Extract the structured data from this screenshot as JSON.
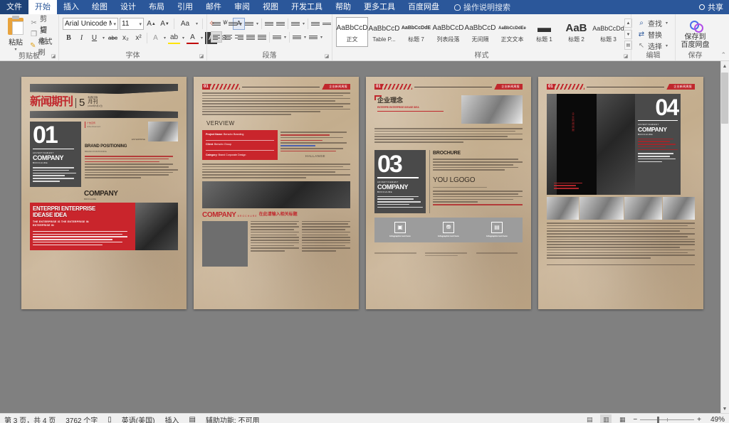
{
  "ribbon": {
    "tabs": [
      {
        "label": "文件",
        "kind": "file"
      },
      {
        "label": "开始",
        "kind": "active"
      },
      {
        "label": "插入",
        "kind": "normal"
      },
      {
        "label": "绘图",
        "kind": "normal"
      },
      {
        "label": "设计",
        "kind": "normal"
      },
      {
        "label": "布局",
        "kind": "normal"
      },
      {
        "label": "引用",
        "kind": "normal"
      },
      {
        "label": "邮件",
        "kind": "normal"
      },
      {
        "label": "审阅",
        "kind": "normal"
      },
      {
        "label": "视图",
        "kind": "normal"
      },
      {
        "label": "开发工具",
        "kind": "normal"
      },
      {
        "label": "帮助",
        "kind": "normal"
      },
      {
        "label": "更多工具",
        "kind": "normal"
      },
      {
        "label": "百度网盘",
        "kind": "normal"
      }
    ],
    "tell_me": "操作说明搜索",
    "share": "共享"
  },
  "clipboard": {
    "group_label": "剪贴板",
    "paste": "粘贴",
    "cut": "剪切",
    "copy": "复制",
    "format_painter": "格式刷"
  },
  "font": {
    "group_label": "字体",
    "font_name": "Arial Unicode M",
    "font_size": "11",
    "grow": "A",
    "shrink": "A",
    "change_case": "Aa",
    "bold": "B",
    "italic": "I",
    "underline": "U",
    "strikethrough": "abc",
    "subscript": "x₂",
    "superscript": "x²",
    "text_effects": "A",
    "highlight": "ab",
    "font_color": "A",
    "char_border": "A",
    "char_shading": "⊜",
    "clear_formatting": "A"
  },
  "paragraph": {
    "group_label": "段落"
  },
  "styles": {
    "group_label": "样式",
    "items": [
      {
        "preview": "AaBbCcD",
        "name": "正文",
        "selected": true,
        "size": "10px",
        "weight": "normal"
      },
      {
        "preview": "AaBbCcD",
        "name": "Table P...",
        "selected": false,
        "size": "10px",
        "weight": "normal"
      },
      {
        "preview": "AaBbCcDdE",
        "name": "标题 7",
        "selected": false,
        "size": "7px",
        "weight": "bold"
      },
      {
        "preview": "AaBbCcD",
        "name": "列表段落",
        "selected": false,
        "size": "10px",
        "weight": "normal"
      },
      {
        "preview": "AaBbCcD",
        "name": "无间隔",
        "selected": false,
        "size": "10px",
        "weight": "normal"
      },
      {
        "preview": "AaBbCcDdEe",
        "name": "正文文本",
        "selected": false,
        "size": "6px",
        "weight": "normal"
      },
      {
        "preview": "▬",
        "name": "标题 1",
        "selected": false,
        "size": "17px",
        "weight": "bold"
      },
      {
        "preview": "AaB",
        "name": "标题 2",
        "selected": false,
        "size": "15px",
        "weight": "bold"
      },
      {
        "preview": "AaBbCcDd",
        "name": "标题 3",
        "selected": false,
        "size": "9px",
        "weight": "normal"
      }
    ]
  },
  "editing": {
    "group_label": "编辑",
    "find": "查找",
    "replace": "替换",
    "select": "选择"
  },
  "save_group": {
    "group_label": "保存",
    "baidu_label": "保存到\n百度网盘",
    "baidu_line1": "保存到",
    "baidu_line2": "百度网盘"
  },
  "document": {
    "pages": [
      {
        "number": "01",
        "title_cn": "新闻期刊",
        "issue_big": "5",
        "issue_unit": "月刊",
        "publisher": "私媒出版",
        "date": "[2018年5月1日]",
        "big_number": "01",
        "label_ad": "ADVERTISEMENT",
        "label_company": "COMPANY",
        "label_brochure": "BROCHURE",
        "kicker_cn": "广告宣传",
        "kicker_en": "Advertisement",
        "kicker_tag": "ENTERPRISE",
        "heading_en": "BRAND POSITIONING",
        "heading_sub": "BRAND POSITIONING",
        "mid_title": "COMPANY",
        "mid_sub": "BROCHURE",
        "red_head1": "ENTERPRI ENTERPRISE",
        "red_head2": "IDEASE IDEA",
        "red_sub1": "THE ENTERPRISE IS THE ENTERPRISE IN",
        "red_sub2": "ENTERPRISE IN"
      },
      {
        "number": "01",
        "header_tag": "企业新闻周报",
        "section_title": "VERVIEW",
        "field1_key": "Project Name",
        "field1_val": ": Berschx  Branding",
        "field2_key": "Client",
        "field2_val": ": Berschx Group",
        "field3_key": "Category",
        "field3_val": ": Brand Corporate Design",
        "challenge": "HALLANGE",
        "company_title": "COMPANY",
        "company_small": "BROCHURE",
        "company_cn": "在此请输入相关标题"
      },
      {
        "number": "01",
        "header_tag": "企业新闻周报",
        "idea_title": "企业理念",
        "idea_en": "ENTERPRI ENTERPRISE IDEASE IDEA",
        "big_number": "03",
        "label_ad": "ADVERTISEMENT",
        "label_company": "COMPANY",
        "label_brochure": "BROCHURE",
        "brochure": "BROCHURE",
        "logo_title": "YOU LGOGO",
        "infographics": [
          "Infographic text here",
          "Infographic text here",
          "Infographic text here"
        ]
      },
      {
        "number": "01",
        "header_tag": "企业新闻周报",
        "big_number": "04",
        "label_ad": "ADVERTISEMENT",
        "label_company": "COMPANY",
        "label_brochure": "BROCHURE",
        "vertical_cn": "企业新闻周报"
      }
    ]
  },
  "status": {
    "page_info": "第 3 页，共 4 页",
    "word_count": "3762 个字",
    "language": "英语(美国)",
    "insert_mode": "插入",
    "accessibility": "辅助功能: 不可用",
    "zoom": "49%",
    "zoom_out": "−",
    "zoom_in": "+"
  }
}
